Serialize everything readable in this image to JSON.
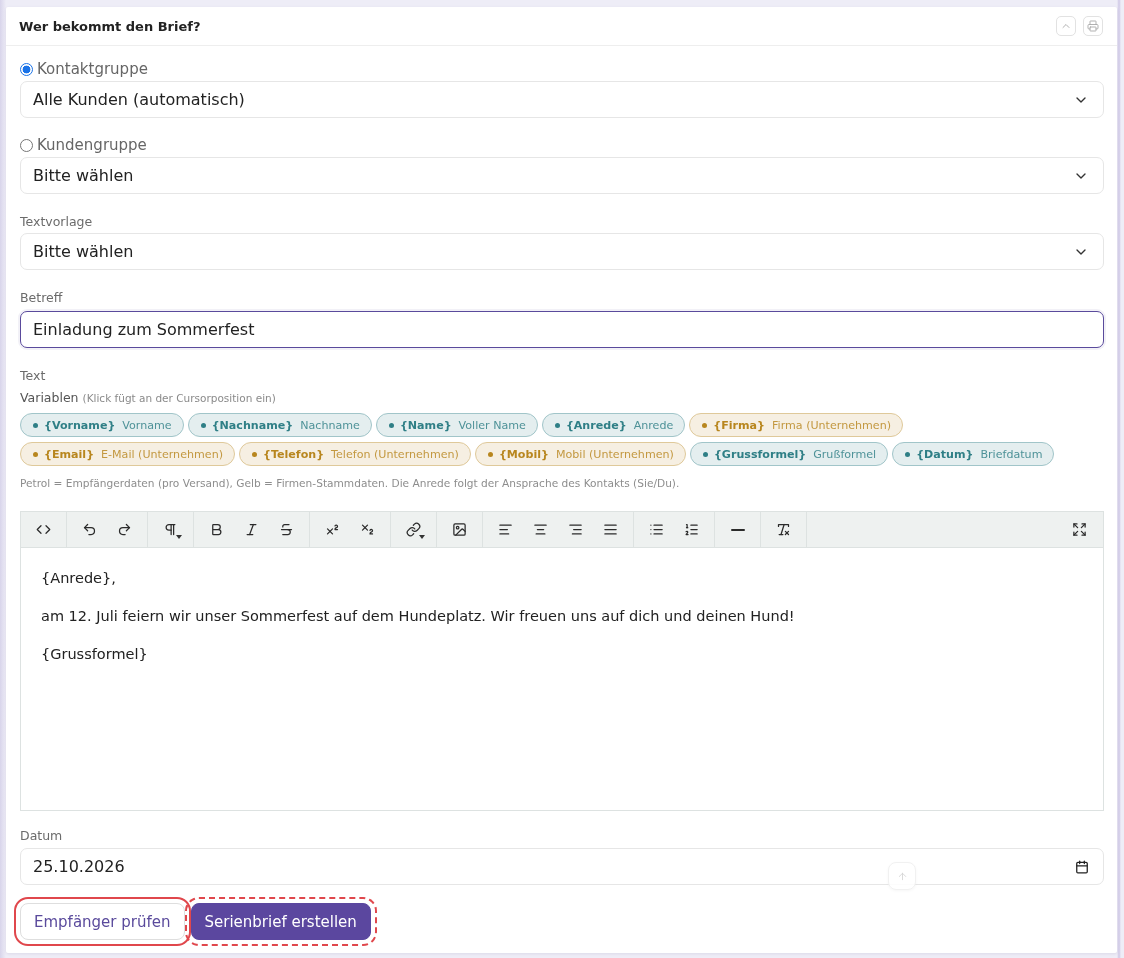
{
  "card": {
    "title": "Wer bekommt den Brief?",
    "actions": [
      {
        "kind": "collapse"
      },
      {
        "kind": "print"
      }
    ]
  },
  "recipient_options": [
    {
      "label": "Kontaktgruppe",
      "selected": true,
      "value": "Alle Kunden (automatisch)"
    },
    {
      "label": "Kundengruppe",
      "selected": false,
      "value": "Bitte wählen"
    }
  ],
  "template": {
    "label": "Textvorlage",
    "value": "Bitte wählen"
  },
  "subject": {
    "label": "Betreff",
    "value": "Einladung zum Sommerfest",
    "focused": true
  },
  "text": {
    "label": "Text",
    "variables_label": "Variablen",
    "variables_hint": "(Klick fügt an der Cursorposition ein)",
    "variables": [
      {
        "token": "{Vorname}",
        "label": "Vorname",
        "color": "#2f7f86"
      },
      {
        "token": "{Nachname}",
        "label": "Nachname",
        "color": "#2f7f86"
      },
      {
        "token": "{Name}",
        "label": "Voller Name",
        "color": "#2f7f86"
      },
      {
        "token": "{Anrede}",
        "label": "Anrede",
        "color": "#2f7f86"
      },
      {
        "token": "{Firma}",
        "label": "Firma (Unternehmen)",
        "color": "#b8861e"
      },
      {
        "token": "{Email}",
        "label": "E-Mail (Unternehmen)",
        "color": "#b8861e"
      },
      {
        "token": "{Telefon}",
        "label": "Telefon (Unternehmen)",
        "color": "#b8861e"
      },
      {
        "token": "{Mobil}",
        "label": "Mobil (Unternehmen)",
        "color": "#b8861e"
      },
      {
        "token": "{Grussformel}",
        "label": "Grußformel",
        "color": "#2f7f86"
      },
      {
        "token": "{Datum}",
        "label": "Briefdatum",
        "color": "#2f7f86"
      }
    ],
    "legend": "Petrol = Empfängerdaten (pro Versand), Gelb = Firmen-Stammdaten. Die Anrede folgt der Ansprache des Kontakts (Sie/Du).",
    "toolbar": {
      "groups": [
        {
          "tools": [
            {
              "kind": "code",
              "menu": false
            }
          ]
        },
        {
          "tools": [
            {
              "kind": "undo",
              "menu": false
            },
            {
              "kind": "redo",
              "menu": false
            }
          ]
        },
        {
          "tools": [
            {
              "kind": "paragraph",
              "menu": true
            }
          ]
        },
        {
          "tools": [
            {
              "kind": "bold",
              "menu": false
            },
            {
              "kind": "italic",
              "menu": false
            },
            {
              "kind": "strikethrough",
              "menu": false
            }
          ]
        },
        {
          "tools": [
            {
              "kind": "superscript",
              "menu": false
            },
            {
              "kind": "subscript",
              "menu": false
            }
          ]
        },
        {
          "tools": [
            {
              "kind": "link",
              "menu": true
            }
          ]
        },
        {
          "tools": [
            {
              "kind": "image",
              "menu": false
            }
          ]
        },
        {
          "tools": [
            {
              "kind": "align_left",
              "menu": false
            },
            {
              "kind": "align_center",
              "menu": false
            },
            {
              "kind": "align_right",
              "menu": false
            },
            {
              "kind": "align_justify",
              "menu": false
            }
          ]
        },
        {
          "tools": [
            {
              "kind": "bullet_list",
              "menu": false
            },
            {
              "kind": "numbered_list",
              "menu": false
            }
          ]
        },
        {
          "tools": [
            {
              "kind": "horizontal_rule",
              "menu": false
            }
          ]
        },
        {
          "tools": [
            {
              "kind": "clear_format",
              "menu": false
            }
          ]
        }
      ],
      "end": [
        {
          "kind": "fullscreen",
          "menu": false
        }
      ]
    },
    "paragraphs": [
      "{Anrede},",
      "am 12. Juli feiern wir unser Sommerfest auf dem Hundeplatz. Wir freuen uns auf dich und deinen Hund!",
      "{Grussformel}"
    ]
  },
  "date": {
    "label": "Datum",
    "value": "25.10.2026"
  },
  "buttons": [
    {
      "label": "Empfänger prüfen",
      "kind": "secondary",
      "highlighted": true,
      "dashed": false
    },
    {
      "label": "Serienbrief erstellen",
      "kind": "primary",
      "highlighted": true,
      "dashed": true
    }
  ]
}
